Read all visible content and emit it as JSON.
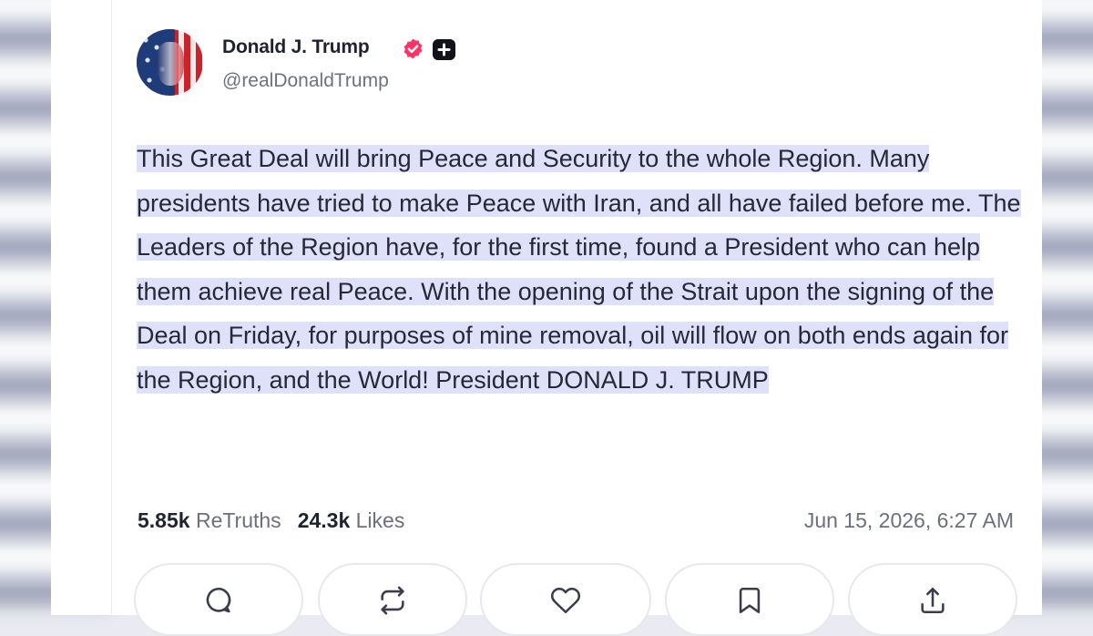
{
  "post": {
    "author": {
      "display_name": "Donald J. Trump",
      "handle": "@realDonaldTrump",
      "verified_badge_icon": "verified-badge-icon",
      "plus_badge_icon": "plus-badge-icon",
      "verified_color": "#ff3366"
    },
    "body": "This Great Deal will bring Peace and Security to the whole Region. Many presidents have tried to make Peace with Iran, and all have failed before me. The Leaders of the Region have, for the first time, found a President who can help them achieve real Peace. With the opening of the Strait upon the signing of the Deal on Friday, for purposes of mine removal, oil will flow on both ends again for the Region, and the World! President DONALD J. TRUMP",
    "stats": {
      "retruths_count": "5.85k",
      "retruths_label": "ReTruths",
      "likes_count": "24.3k",
      "likes_label": "Likes"
    },
    "timestamp": "Jun 15, 2026, 6:27 AM",
    "actions": [
      {
        "name": "reply",
        "icon": "comment-icon"
      },
      {
        "name": "retruth",
        "icon": "repost-icon"
      },
      {
        "name": "like",
        "icon": "heart-icon"
      },
      {
        "name": "bookmark",
        "icon": "bookmark-icon"
      },
      {
        "name": "share",
        "icon": "share-icon"
      }
    ],
    "highlight_color": "#dfe1fb"
  }
}
